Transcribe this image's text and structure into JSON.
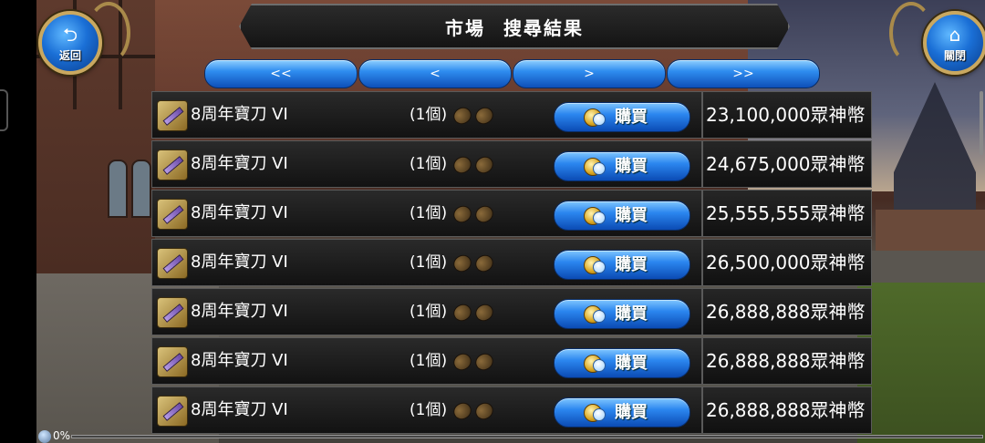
{
  "header": {
    "title_part1": "市場",
    "title_part2": "搜尋結果",
    "back_label": "返回",
    "close_label": "關閉"
  },
  "pager": {
    "first": "<<",
    "prev": "<",
    "next": ">",
    "last": ">>"
  },
  "listings": [
    {
      "name": "8周年寶刀 VI",
      "qty": "(1個)",
      "buy_label": "購買",
      "price": "23,100,000眾神幣"
    },
    {
      "name": "8周年寶刀 VI",
      "qty": "(1個)",
      "buy_label": "購買",
      "price": "24,675,000眾神幣"
    },
    {
      "name": "8周年寶刀 VI",
      "qty": "(1個)",
      "buy_label": "購買",
      "price": "25,555,555眾神幣"
    },
    {
      "name": "8周年寶刀 VI",
      "qty": "(1個)",
      "buy_label": "購買",
      "price": "26,500,000眾神幣"
    },
    {
      "name": "8周年寶刀 VI",
      "qty": "(1個)",
      "buy_label": "購買",
      "price": "26,888,888眾神幣"
    },
    {
      "name": "8周年寶刀 VI",
      "qty": "(1個)",
      "buy_label": "購買",
      "price": "26,888,888眾神幣"
    },
    {
      "name": "8周年寶刀 VI",
      "qty": "(1個)",
      "buy_label": "購買",
      "price": "26,888,888眾神幣"
    }
  ],
  "status": {
    "progress_text": "0%",
    "progress_fraction": 0
  },
  "colors": {
    "button_blue": "#2b86ef",
    "frame_gold": "#c9a860",
    "row_bg": "#1a1a1a"
  },
  "icons": {
    "back": "back-arrow-icon",
    "close": "home-icon",
    "item": "sword-icon",
    "slot": "seed-slot-icon",
    "buy": "coin-icon",
    "status": "globe-icon"
  }
}
